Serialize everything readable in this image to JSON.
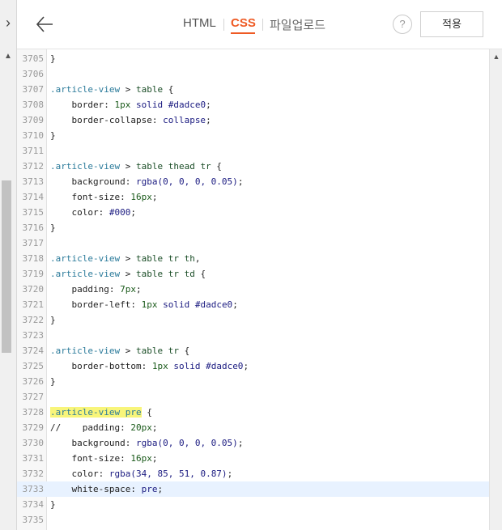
{
  "toolbar": {
    "back_icon": "arrow-left-icon",
    "tabs": [
      {
        "label": "HTML",
        "active": false
      },
      {
        "label": "CSS",
        "active": true
      },
      {
        "label": "파일업로드",
        "active": false
      }
    ],
    "help_label": "?",
    "apply_label": "적용",
    "accent_color": "#ee5a24"
  },
  "sidebar": {
    "collapse_icon": "chevron-right-icon"
  },
  "editor": {
    "highlighted_line": 3733,
    "lines": [
      {
        "n": "3705",
        "parts": [
          [
            "p",
            "}"
          ]
        ]
      },
      {
        "n": "3706",
        "parts": []
      },
      {
        "n": "3707",
        "parts": [
          [
            "s",
            ".article-view"
          ],
          [
            "p",
            " > "
          ],
          [
            "t",
            "table"
          ],
          [
            "p",
            " {"
          ]
        ]
      },
      {
        "n": "3708",
        "parts": [
          [
            "p",
            "    border: "
          ],
          [
            "num",
            "1px"
          ],
          [
            "v",
            " solid #dadce0"
          ],
          [
            "p",
            ";"
          ]
        ]
      },
      {
        "n": "3709",
        "parts": [
          [
            "p",
            "    border-collapse: "
          ],
          [
            "v",
            "collapse"
          ],
          [
            "p",
            ";"
          ]
        ]
      },
      {
        "n": "3710",
        "parts": [
          [
            "p",
            "}"
          ]
        ]
      },
      {
        "n": "3711",
        "parts": []
      },
      {
        "n": "3712",
        "parts": [
          [
            "s",
            ".article-view"
          ],
          [
            "p",
            " > "
          ],
          [
            "t",
            "table thead tr"
          ],
          [
            "p",
            " {"
          ]
        ]
      },
      {
        "n": "3713",
        "parts": [
          [
            "p",
            "    background: "
          ],
          [
            "v",
            "rgba(0, 0, 0, 0.05)"
          ],
          [
            "p",
            ";"
          ]
        ]
      },
      {
        "n": "3714",
        "parts": [
          [
            "p",
            "    font-size: "
          ],
          [
            "num",
            "16px"
          ],
          [
            "p",
            ";"
          ]
        ]
      },
      {
        "n": "3715",
        "parts": [
          [
            "p",
            "    color: "
          ],
          [
            "v",
            "#000"
          ],
          [
            "p",
            ";"
          ]
        ]
      },
      {
        "n": "3716",
        "parts": [
          [
            "p",
            "}"
          ]
        ]
      },
      {
        "n": "3717",
        "parts": []
      },
      {
        "n": "3718",
        "parts": [
          [
            "s",
            ".article-view"
          ],
          [
            "p",
            " > "
          ],
          [
            "t",
            "table tr th"
          ],
          [
            "p",
            ","
          ]
        ]
      },
      {
        "n": "3719",
        "parts": [
          [
            "s",
            ".article-view"
          ],
          [
            "p",
            " > "
          ],
          [
            "t",
            "table tr td"
          ],
          [
            "p",
            " {"
          ]
        ]
      },
      {
        "n": "3720",
        "parts": [
          [
            "p",
            "    padding: "
          ],
          [
            "num",
            "7px"
          ],
          [
            "p",
            ";"
          ]
        ]
      },
      {
        "n": "3721",
        "parts": [
          [
            "p",
            "    border-left: "
          ],
          [
            "num",
            "1px"
          ],
          [
            "v",
            " solid #dadce0"
          ],
          [
            "p",
            ";"
          ]
        ]
      },
      {
        "n": "3722",
        "parts": [
          [
            "p",
            "}"
          ]
        ]
      },
      {
        "n": "3723",
        "parts": []
      },
      {
        "n": "3724",
        "parts": [
          [
            "s",
            ".article-view"
          ],
          [
            "p",
            " > "
          ],
          [
            "t",
            "table tr"
          ],
          [
            "p",
            " {"
          ]
        ]
      },
      {
        "n": "3725",
        "parts": [
          [
            "p",
            "    border-bottom: "
          ],
          [
            "num",
            "1px"
          ],
          [
            "v",
            " solid #dadce0"
          ],
          [
            "p",
            ";"
          ]
        ]
      },
      {
        "n": "3726",
        "parts": [
          [
            "p",
            "}"
          ]
        ]
      },
      {
        "n": "3727",
        "parts": []
      },
      {
        "n": "3728",
        "parts": [
          [
            "m",
            ".article-view pre"
          ],
          [
            "p",
            " {"
          ]
        ]
      },
      {
        "n": "3729",
        "parts": [
          [
            "p",
            "//    padding: "
          ],
          [
            "num",
            "20px"
          ],
          [
            "p",
            ";"
          ]
        ]
      },
      {
        "n": "3730",
        "parts": [
          [
            "p",
            "    background: "
          ],
          [
            "v",
            "rgba(0, 0, 0, 0.05)"
          ],
          [
            "p",
            ";"
          ]
        ]
      },
      {
        "n": "3731",
        "parts": [
          [
            "p",
            "    font-size: "
          ],
          [
            "num",
            "16px"
          ],
          [
            "p",
            ";"
          ]
        ]
      },
      {
        "n": "3732",
        "parts": [
          [
            "p",
            "    color: "
          ],
          [
            "v",
            "rgba(34, 85, 51, 0.87)"
          ],
          [
            "p",
            ";"
          ]
        ]
      },
      {
        "n": "3733",
        "parts": [
          [
            "p",
            "    white-space: "
          ],
          [
            "v",
            "pre"
          ],
          [
            "p",
            ";"
          ]
        ]
      },
      {
        "n": "3734",
        "parts": [
          [
            "p",
            "}"
          ]
        ]
      },
      {
        "n": "3735",
        "parts": []
      }
    ]
  }
}
